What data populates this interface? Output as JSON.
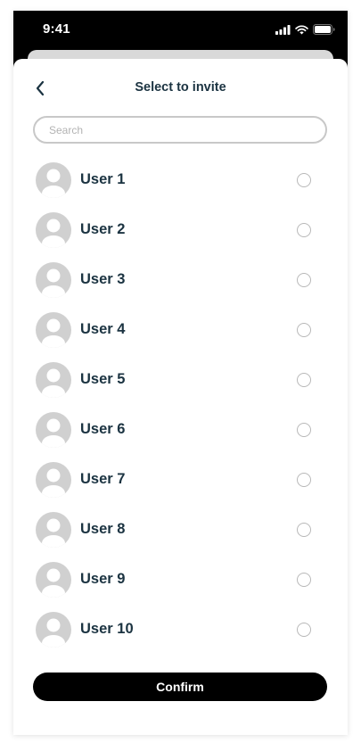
{
  "status_bar": {
    "time": "9:41"
  },
  "header": {
    "title": "Select to invite",
    "back_icon": "chevron-left-icon"
  },
  "search": {
    "placeholder": "Search",
    "value": ""
  },
  "users": [
    {
      "name": "User 1",
      "selected": false
    },
    {
      "name": "User 2",
      "selected": false
    },
    {
      "name": "User 3",
      "selected": false
    },
    {
      "name": "User 4",
      "selected": false
    },
    {
      "name": "User 5",
      "selected": false
    },
    {
      "name": "User 6",
      "selected": false
    },
    {
      "name": "User 7",
      "selected": false
    },
    {
      "name": "User 8",
      "selected": false
    },
    {
      "name": "User 9",
      "selected": false
    },
    {
      "name": "User 10",
      "selected": false
    }
  ],
  "confirm": {
    "label": "Confirm"
  },
  "colors": {
    "text_primary": "#1b3341",
    "button_bg": "#000000",
    "avatar_bg": "#d0d0d0",
    "radio_border": "#b8b8b8"
  }
}
